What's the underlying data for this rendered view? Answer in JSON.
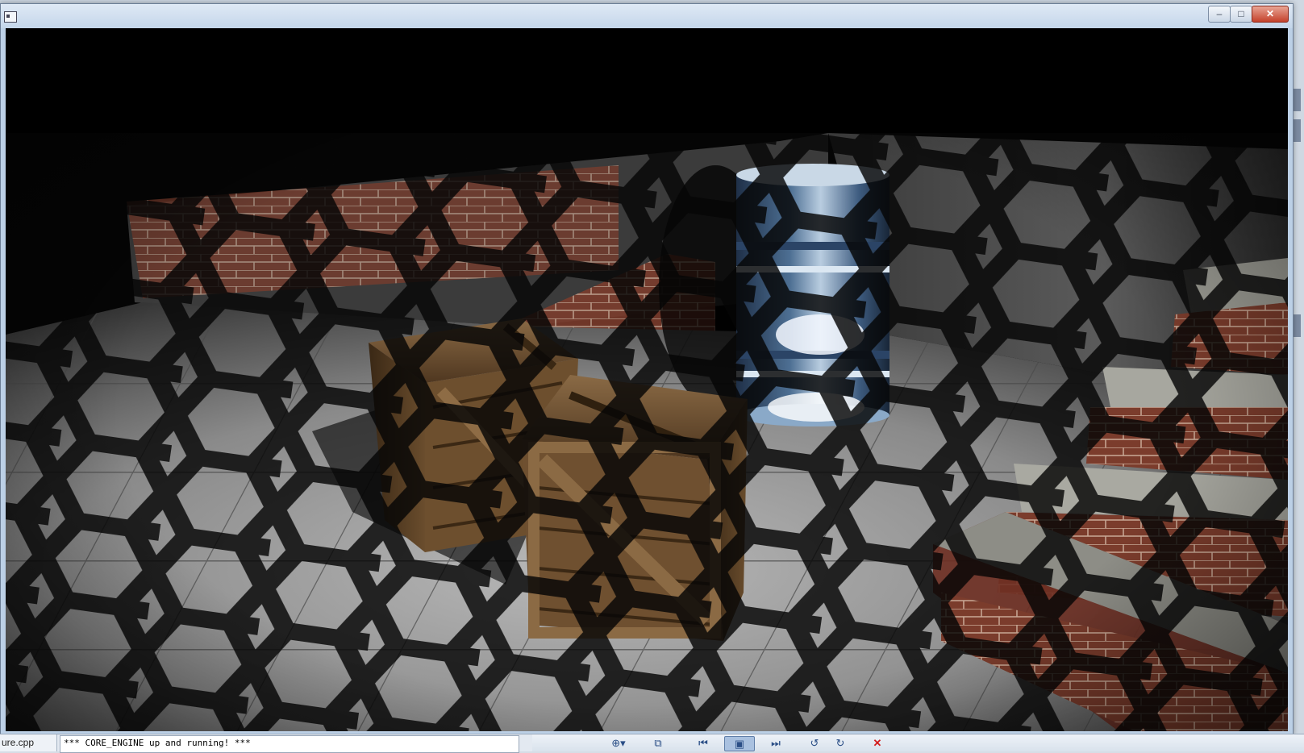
{
  "window": {
    "title": "",
    "minimize_glyph": "‒",
    "maximize_glyph": "□",
    "close_glyph": "✕"
  },
  "scene": {
    "objects": [
      "floor-tiles",
      "brick-wall",
      "wooden-crate",
      "wooden-crate",
      "metal-barrel",
      "brick-stairs",
      "hexagonal-mesh-shadow"
    ]
  },
  "bottom_bar": {
    "file_tab": "ure.cpp",
    "console_text": "*** CORE_ENGINE up and running! ***",
    "toolbar": [
      {
        "name": "zoom-icon",
        "glyph": "⊕▾"
      },
      {
        "name": "fit-icon",
        "glyph": "⧉"
      },
      {
        "name": "first-frame-icon",
        "glyph": "⏮"
      },
      {
        "name": "capture-icon",
        "glyph": "▣"
      },
      {
        "name": "last-frame-icon",
        "glyph": "⏭"
      },
      {
        "name": "rotate-left-icon",
        "glyph": "↺"
      },
      {
        "name": "rotate-right-icon",
        "glyph": "↻"
      },
      {
        "name": "close-icon",
        "glyph": "✕"
      }
    ]
  }
}
